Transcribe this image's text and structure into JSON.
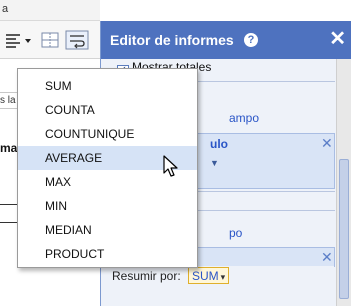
{
  "spreadsheet": {
    "top_fragment": "a",
    "cell_fragment": "s la",
    "bold_fragment": "ma"
  },
  "panel": {
    "title": "Editor de informes",
    "show_totals_label": "Mostrar totales",
    "field_link_1": "ampo",
    "value_box_title": "ulo",
    "field_link_2": "po",
    "summarize_label": "Resumir por:",
    "summarize_value": "SUM"
  },
  "menu": {
    "items": [
      "SUM",
      "COUNTA",
      "COUNTUNIQUE",
      "AVERAGE",
      "MAX",
      "MIN",
      "MEDIAN",
      "PRODUCT"
    ],
    "highlighted_index": 3
  },
  "colors": {
    "header_blue": "#4e72bf",
    "menu_highlight": "#d6e3f6",
    "link_blue": "#2a55c7"
  }
}
